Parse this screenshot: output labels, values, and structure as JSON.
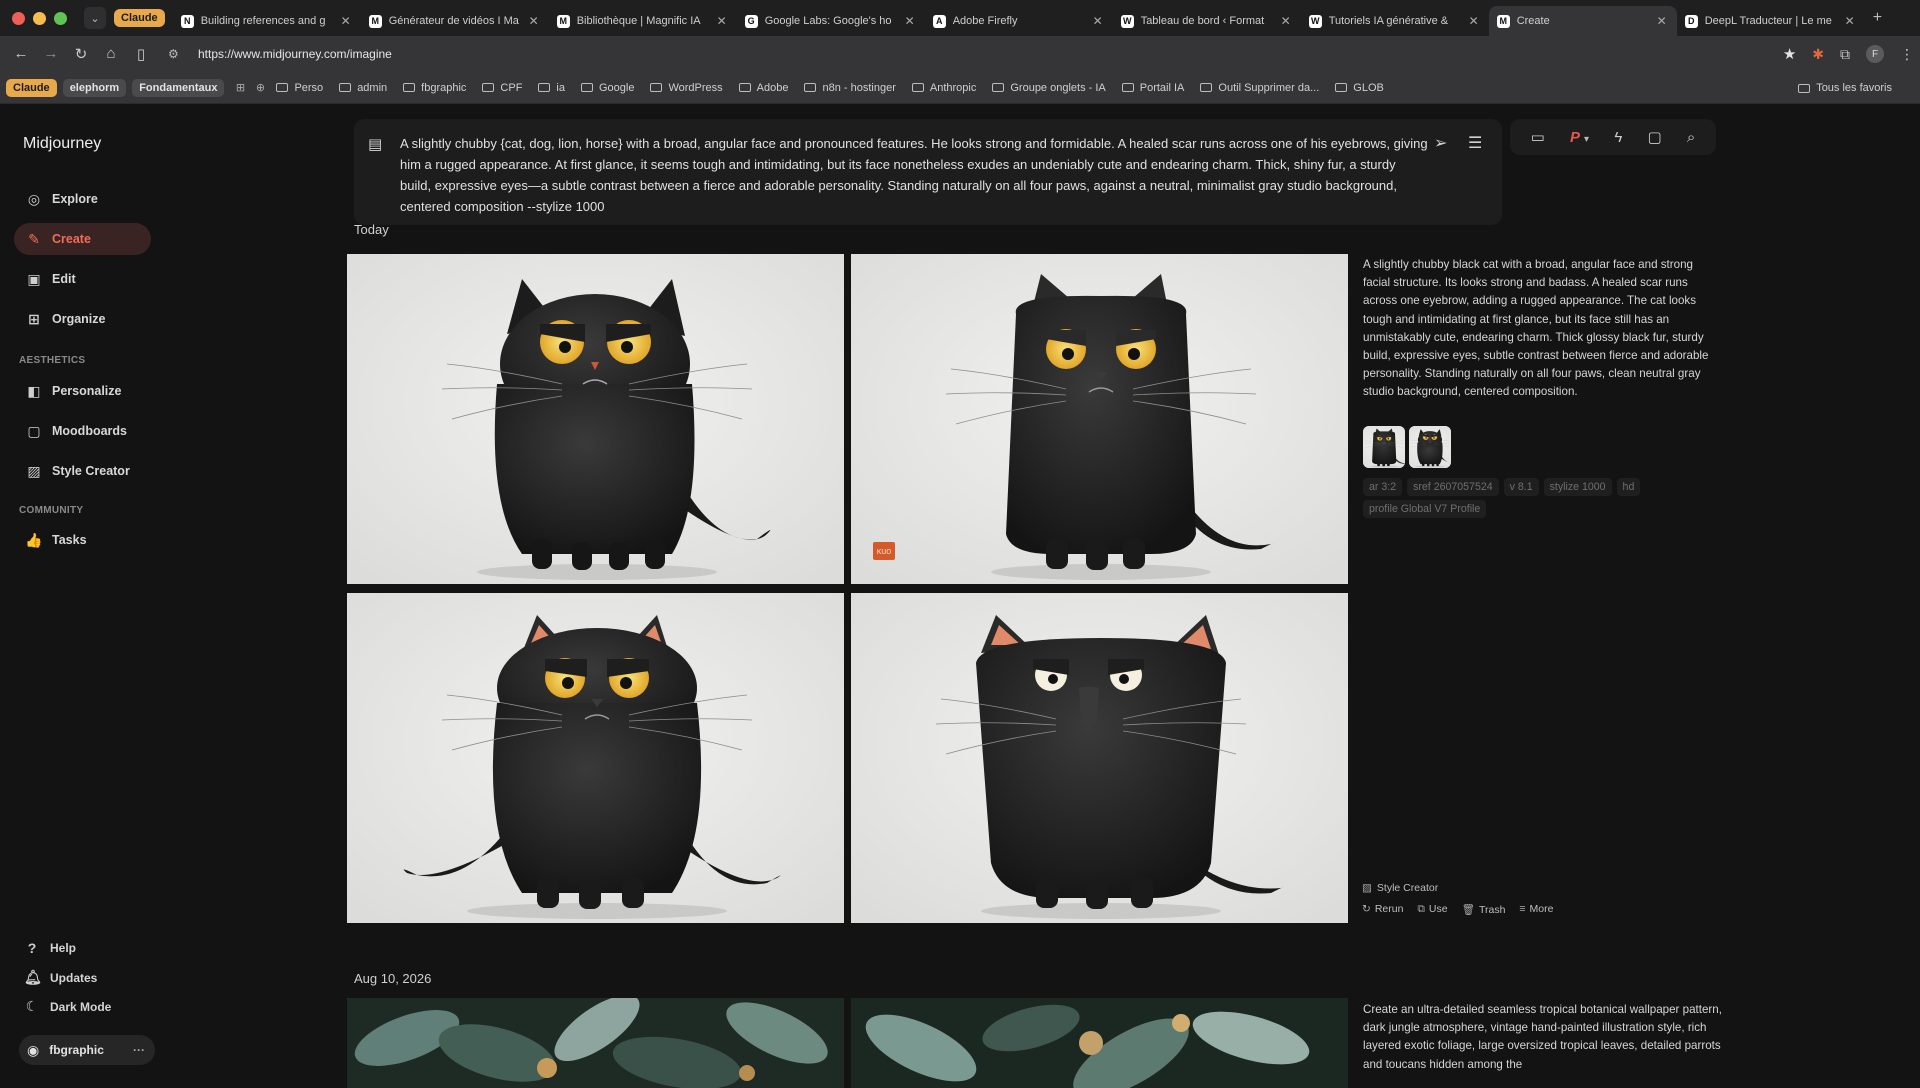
{
  "browser": {
    "tab_group_label": "Claude",
    "tabs": [
      {
        "favicon": "N",
        "title": "Building references and g",
        "active": false
      },
      {
        "favicon": "M",
        "title": "Générateur de vidéos I Ma",
        "active": false
      },
      {
        "favicon": "M",
        "title": "Bibliothèque | Magnific IA",
        "active": false
      },
      {
        "favicon": "G",
        "title": "Google Labs: Google's ho",
        "active": false
      },
      {
        "favicon": "A",
        "title": "Adobe Firefly",
        "active": false
      },
      {
        "favicon": "W",
        "title": "Tableau de bord ‹ Format",
        "active": false
      },
      {
        "favicon": "W",
        "title": "Tutoriels IA générative &",
        "active": false
      },
      {
        "favicon": "M",
        "title": "Create",
        "active": true
      },
      {
        "favicon": "D",
        "title": "DeepL Traducteur | Le me",
        "active": false
      }
    ],
    "url": "https://www.midjourney.com/imagine",
    "bookmarks_chips": [
      "Claude",
      "elephorm",
      "Fondamentaux"
    ],
    "bookmarks": [
      "Perso",
      "admin",
      "fbgraphic",
      "CPF",
      "ia",
      "Google",
      "WordPress",
      "Adobe",
      "n8n - hostinger",
      "Anthropic",
      "Groupe onglets - IA",
      "Portail IA",
      "Outil Supprimer da...",
      "GLOB"
    ],
    "bookmarks_all": "Tous les favoris"
  },
  "sidebar": {
    "brand": "Midjourney",
    "items": [
      {
        "label": "Explore",
        "icon": "compass-icon"
      },
      {
        "label": "Create",
        "icon": "brush-icon",
        "active": true
      },
      {
        "label": "Edit",
        "icon": "edit-icon"
      },
      {
        "label": "Organize",
        "icon": "grid-icon"
      }
    ],
    "aesthetics_label": "AESTHETICS",
    "aesthetics": [
      {
        "label": "Personalize",
        "icon": "personalize-icon"
      },
      {
        "label": "Moodboards",
        "icon": "moodboard-icon"
      },
      {
        "label": "Style Creator",
        "icon": "style-creator-icon"
      }
    ],
    "community_label": "COMMUNITY",
    "community": [
      {
        "label": "Tasks",
        "icon": "thumbs-up-icon"
      }
    ],
    "footer": [
      {
        "label": "Help",
        "icon": "help-icon"
      },
      {
        "label": "Updates",
        "icon": "bell-icon"
      },
      {
        "label": "Dark Mode",
        "icon": "moon-icon"
      }
    ],
    "account": "fbgraphic"
  },
  "prompt": {
    "text": "A slightly chubby {cat, dog, lion, horse} with a broad, angular face and pronounced features. He looks strong and formidable. A healed scar runs across one of his eyebrows, giving him a rugged appearance. At first glance, it seems tough and intimidating, but its face nonetheless exudes an undeniably cute and endearing charm. Thick, shiny fur, a sturdy build, expressive eyes—a subtle contrast between a fierce and adorable personality. Standing naturally on all four paws, against a neutral, minimalist gray studio background, centered composition --stylize 1000"
  },
  "toolpill": {
    "personalize_letter": "P"
  },
  "feed": {
    "groups": [
      {
        "date": "Today",
        "description": "A slightly chubby black cat with a broad, angular face and strong facial structure. Its looks strong and badass. A healed scar runs across one eyebrow, adding a rugged appearance. The cat looks tough and intimidating at first glance, but its face still has an unmistakably cute, endearing charm. Thick glossy black fur, sturdy build, expressive eyes, subtle contrast between fierce and adorable personality. Standing naturally on all four paws, clean neutral gray studio background, centered composition.",
        "params": [
          "ar 3:2",
          "sref 2607057524",
          "v 8.1",
          "stylize 1000",
          "hd",
          "profile Global V7 Profile"
        ],
        "style_creator_label": "Style Creator",
        "actions": [
          {
            "label": "Rerun",
            "icon": "rerun-icon"
          },
          {
            "label": "Use",
            "icon": "use-icon"
          },
          {
            "label": "Trash",
            "icon": "trash-icon"
          },
          {
            "label": "More",
            "icon": "more-icon"
          }
        ],
        "badge": "ĸuo"
      },
      {
        "date": "Aug 10, 2026",
        "description": "Create an ultra-detailed seamless tropical botanical wallpaper pattern, dark jungle atmosphere, vintage hand-painted illustration style, rich layered exotic foliage, large oversized tropical leaves, detailed parrots and toucans hidden among the"
      }
    ]
  }
}
